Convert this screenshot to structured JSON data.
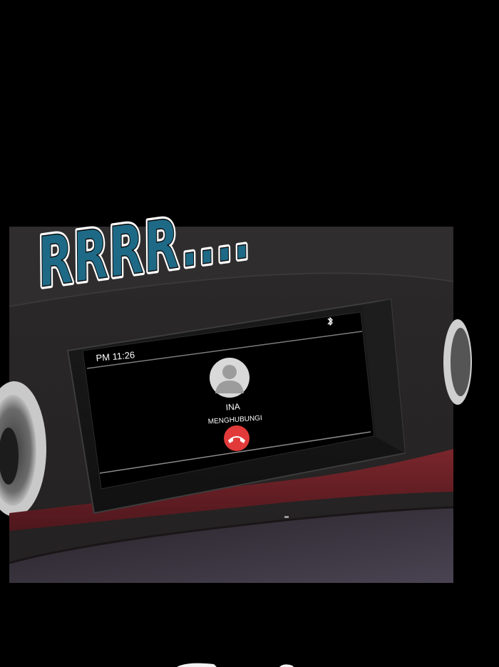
{
  "sound_effect": {
    "text": "RRRR....",
    "color": "#1e6a86"
  },
  "car_display": {
    "time": "PM 11:26",
    "status_icon": "bluetooth-icon",
    "caller": {
      "avatar_icon": "person-silhouette-icon",
      "name": "INA",
      "status": "MENGHUBUNGI"
    },
    "action": {
      "icon": "phone-hangup-icon",
      "color": "#e23a3a"
    }
  },
  "colors": {
    "dashboard_trim": "#6e2026",
    "panel_bg": "#2a2828",
    "screen_bg": "#000000"
  }
}
